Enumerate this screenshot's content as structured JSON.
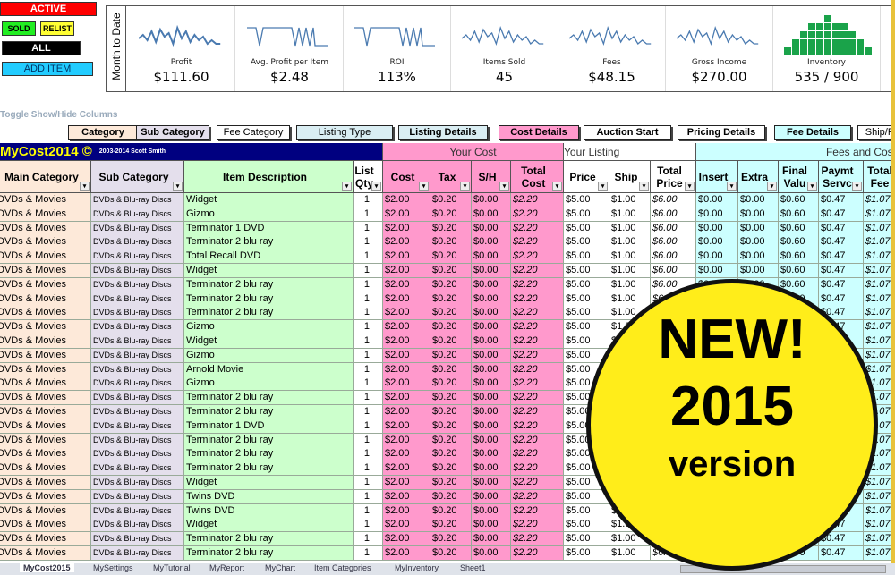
{
  "buttons": {
    "active": "ACTIVE",
    "sold": "SOLD",
    "relist": "RELIST",
    "all": "ALL",
    "add_item": "ADD ITEM"
  },
  "dashboard": {
    "side_label": "Month to Date",
    "kpis": [
      {
        "label": "Profit",
        "value": "$111.60",
        "chart": "sparkline"
      },
      {
        "label": "Avg. Profit per Item",
        "value": "$2.48",
        "chart": "sparkline"
      },
      {
        "label": "ROI",
        "value": "113%",
        "chart": "sparkline"
      },
      {
        "label": "Items Sold",
        "value": "45",
        "chart": "sparkline"
      },
      {
        "label": "Fees",
        "value": "$48.15",
        "chart": "sparkline"
      },
      {
        "label": "Gross Income",
        "value": "$270.00",
        "chart": "sparkline"
      },
      {
        "label": "Inventory",
        "value": "535 / 900",
        "chart": "column"
      }
    ]
  },
  "toggle": {
    "label": "Toggle Show/Hide Columns",
    "buttons": [
      "Category",
      "Sub Category",
      "Fee Category",
      "Listing Type",
      "Listing Details",
      "Cost Details",
      "Auction Start",
      "Pricing Details",
      "Fee Details",
      "Ship/P"
    ]
  },
  "title": {
    "name": "MyCost2014 ©",
    "copyright": "2003-2014 Scott Smith"
  },
  "groups": {
    "your_cost": "Your Cost",
    "your_listing": "Your Listing",
    "fees": "Fees and Costs"
  },
  "columns": [
    "Main Category",
    "Sub Category",
    "Item Description",
    "List Qty",
    "Cost",
    "Tax",
    "S/H",
    "Total Cost",
    "Price",
    "Ship",
    "Total Price",
    "Insert",
    "Extra",
    "Final Valu",
    "Paymt Servc",
    "Total Fee"
  ],
  "row_defaults": {
    "main": "DVDs & Movies",
    "sub": "DVDs & Blu-ray Discs",
    "qty": "1",
    "cost": "$2.00",
    "tax": "$0.20",
    "sh": "$0.00",
    "total_cost": "$2.20",
    "price": "$5.00",
    "ship": "$1.00",
    "total_price": "$6.00",
    "insert": "$0.00",
    "extra": "$0.00",
    "final": "$0.60",
    "paymt": "$0.47",
    "total_fee": "$1.07"
  },
  "rows": [
    "Widget",
    "Gizmo",
    "Terminator 1 DVD",
    "Terminator 2 blu ray",
    "Total Recall DVD",
    "Widget",
    "Terminator 2 blu ray",
    "Terminator 2 blu ray",
    "Terminator 2 blu ray",
    "Gizmo",
    "Widget",
    "Gizmo",
    "Arnold Movie",
    "Gizmo",
    "Terminator 2 blu ray",
    "Terminator 2 blu ray",
    "Terminator 1 DVD",
    "Terminator 2 blu ray",
    "Terminator 2 blu ray",
    "Terminator 2 blu ray",
    "Widget",
    "Twins DVD",
    "Twins DVD",
    "Widget",
    "Terminator 2 blu ray",
    "Terminator 2 blu ray"
  ],
  "sheet_tabs": [
    "MyCost2015",
    "MySettings",
    "MyTutorial",
    "MyReport",
    "MyChart",
    "Item Categories",
    "MyInventory",
    "Sheet1"
  ],
  "badge": {
    "line1": "NEW!",
    "line2": "2015",
    "line3": "version"
  },
  "colors": {
    "navy": "#000080",
    "pink": "#ff99cc",
    "cyan": "#ccffff",
    "green": "#ccffcc",
    "peach": "#fde9d9",
    "lavender": "#e4dfec",
    "inventory": "#1aa34a"
  }
}
